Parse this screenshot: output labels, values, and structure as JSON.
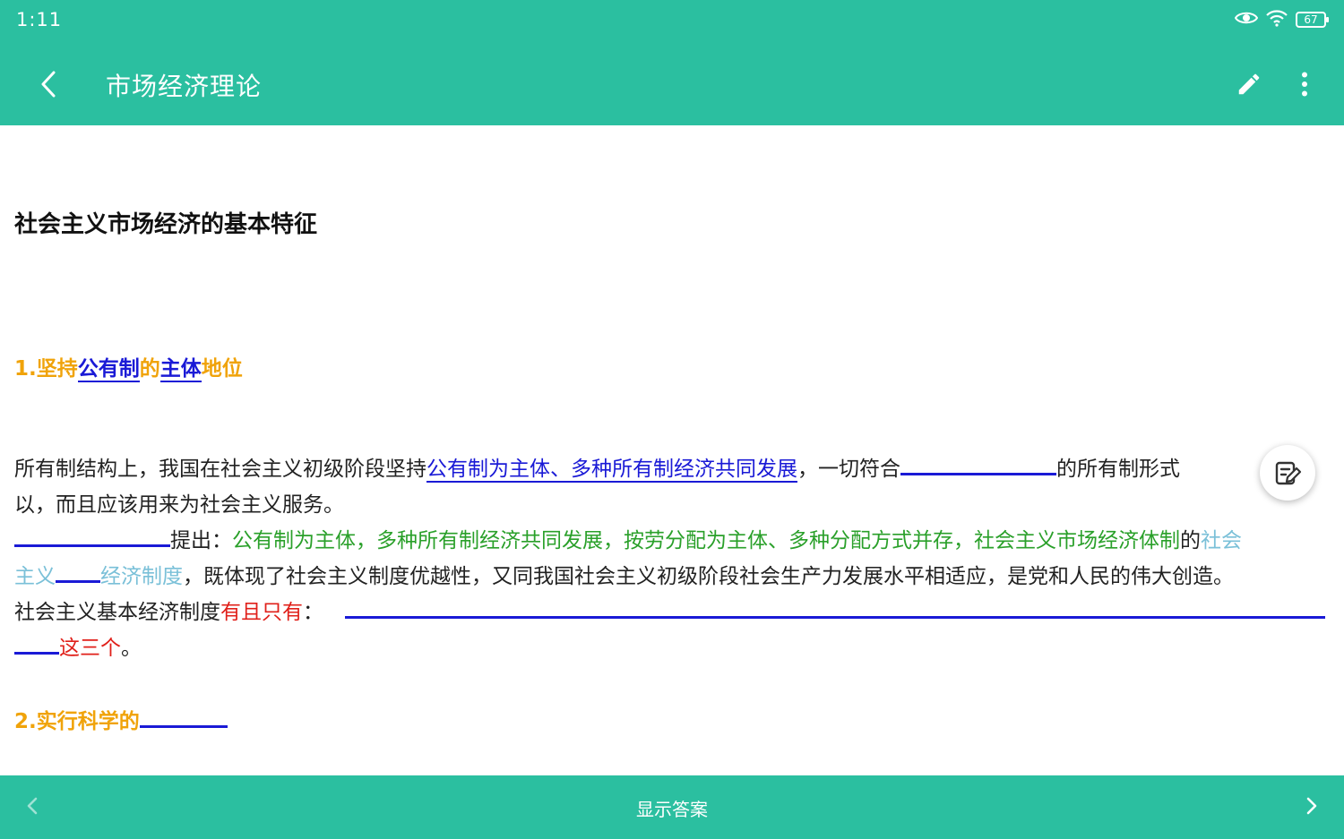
{
  "status_bar": {
    "time": "1:11",
    "battery_level": "67",
    "icons": [
      "eye-icon",
      "wifi-icon",
      "battery-icon"
    ]
  },
  "app_bar": {
    "title": "市场经济理论",
    "actions": [
      "edit-icon",
      "more-vert-icon"
    ]
  },
  "content": {
    "title": "社会主义市场经济的基本特征",
    "heading_1": {
      "prefix": "1.坚持",
      "term_1": "公有制",
      "mid": "的",
      "term_2": "主体",
      "suffix": "地位"
    },
    "paragraph": {
      "l1_text1": "所有制结构上，我国在社会主义初级阶段坚持",
      "l1_blue": "公有制为主体、多种所有制经济共同发展",
      "l1_text2": "，一切符合",
      "l1_text3": "的所有制形式",
      "l2_text": "以，而且应该用来为社会主义服务。",
      "l3_text1": "提出：",
      "l3_green": "公有制为主体，多种所有制经济共同发展，按劳分配为主体、多种分配方式并存，社会主义市场经济体制",
      "l3_text2": "的",
      "l3_lightblue": "社会",
      "l4_lightblue1": "主义",
      "l4_lightblue2": "经济制度",
      "l4_text": "，既体现了社会主义制度优越性，又同我国社会主义初级阶段社会生产力发展水平相适应，是党和人民的伟大创造。",
      "l5_text1": "社会主义基本经济制度",
      "l5_red": "有且只有",
      "l5_text2": "：",
      "l6_red": "这三个",
      "l6_text": "。"
    },
    "heading_2": "2.实行科学的"
  },
  "bottom_bar": {
    "show_answer": "显示答案"
  },
  "colors": {
    "primary": "#2bbfa0",
    "heading": "#f0a30a",
    "highlight_blue": "#1a1ad6",
    "highlight_green": "#2aa02a",
    "highlight_lightblue": "#7ac0d8",
    "highlight_red": "#e0201a"
  }
}
